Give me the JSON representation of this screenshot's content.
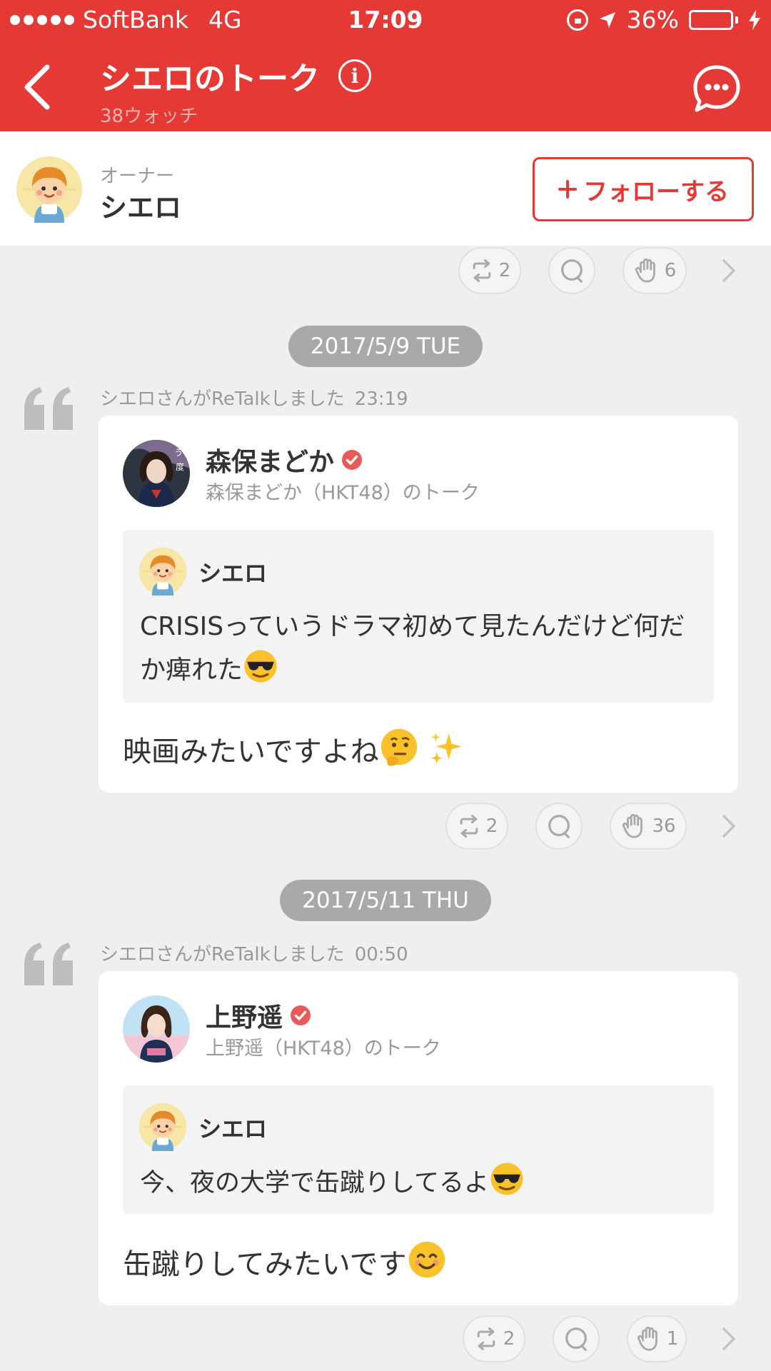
{
  "status_bar": {
    "carrier": "SoftBank",
    "network": "4G",
    "time": "17:09",
    "battery": "36%",
    "battery_level": 0.36
  },
  "header": {
    "title": "シエロのトーク",
    "subtitle": "38ウォッチ",
    "info_glyph": "i"
  },
  "owner": {
    "role": "オーナー",
    "name": "シエロ",
    "follow_label": "フォローする"
  },
  "top_actions": {
    "retalk": "2",
    "clap": "6"
  },
  "posts": [
    {
      "date": "2017/5/9 TUE",
      "retalk_text": "シエロさんがReTalkしました",
      "time": "23:19",
      "author": "森保まどか",
      "talk_name": "森保まどか（HKT48）のトーク",
      "quoted_name": "シエロ",
      "quoted_text": "CRISISっていうドラマ初めて見たんだけど何だか痺れた",
      "reply": "映画みたいですよね",
      "retalk_count": "2",
      "clap_count": "36"
    },
    {
      "date": "2017/5/11 THU",
      "retalk_text": "シエロさんがReTalkしました",
      "time": "00:50",
      "author": "上野遥",
      "talk_name": "上野遥（HKT48）のトーク",
      "quoted_name": "シエロ",
      "quoted_text": "今、夜の大学で缶蹴りしてるよ",
      "reply": "缶蹴りしてみたいです",
      "retalk_count": "2",
      "clap_count": "1"
    }
  ],
  "colors": {
    "brand": "#e53935",
    "date_chip": "#a9a9a9",
    "verified": "#e85a5a"
  },
  "icons": [
    "back-icon",
    "info-icon",
    "chat-bubble-icon",
    "retalk-icon",
    "comment-icon",
    "clap-icon",
    "chevron-right-icon",
    "quote-icon",
    "verified-icon"
  ]
}
